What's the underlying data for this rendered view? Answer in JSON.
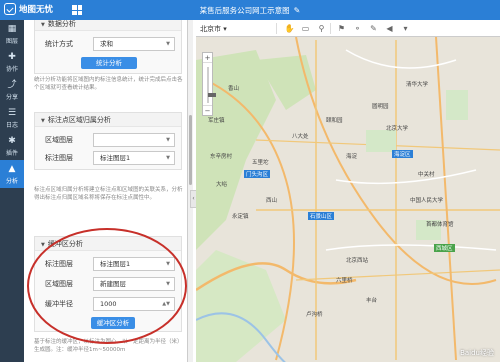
{
  "app": {
    "name": "地图无忧",
    "title": "某售后服务公司网工示意图"
  },
  "nav": [
    {
      "icon": "▦",
      "label": "图层"
    },
    {
      "icon": "✚",
      "label": "协作"
    },
    {
      "icon": "⤴",
      "label": "分享"
    },
    {
      "icon": "☰",
      "label": "日志"
    },
    {
      "icon": "✱",
      "label": "插件"
    },
    {
      "icon": "▲",
      "label": "分析",
      "active": true
    }
  ],
  "stats": {
    "title": "数据分析",
    "method_label": "统计方式",
    "method_value": "求和",
    "button": "统计分析",
    "desc": "统计分析功能将区域图内的标注信息统计，统计完成后点击各个区域就可查看统计结果。"
  },
  "attribution": {
    "title": "标注点区域归属分析",
    "area_label": "区域图层",
    "area_value": "",
    "marker_label": "标注图层",
    "marker_value": "标注图层1",
    "desc": "标注点区域归属分析将建立标注点和区域图的关联关系，分析得出标注点归属区域名称将保存在标注点属性中。"
  },
  "buffer": {
    "title": "缓冲区分析",
    "marker_label": "标注图层",
    "marker_value": "标注图层1",
    "area_label": "区域图层",
    "area_value": "新建图层",
    "radius_label": "缓冲半径",
    "radius_value": "1000",
    "button": "缓冲区分析",
    "desc": "基于标注的缓冲区，以标注为圆心，以一定距离为半径（米）生成圆。注：缓冲半径1m~50000m"
  },
  "map": {
    "city": "北京市",
    "labels": [
      "门头沟区",
      "石景山区",
      "海淀区",
      "西城区",
      "五里坨",
      "北京西站",
      "永定镇",
      "大峪",
      "东辛房村",
      "西山",
      "香山",
      "军庄镇",
      "中关村",
      "颐和园",
      "首都体育馆",
      "中国人民大学",
      "北京大学",
      "清华大学",
      "海淀",
      "圆明园",
      "八大处",
      "卢沟桥",
      "丰台",
      "六里桥"
    ],
    "watermark": "Baidu经验"
  }
}
